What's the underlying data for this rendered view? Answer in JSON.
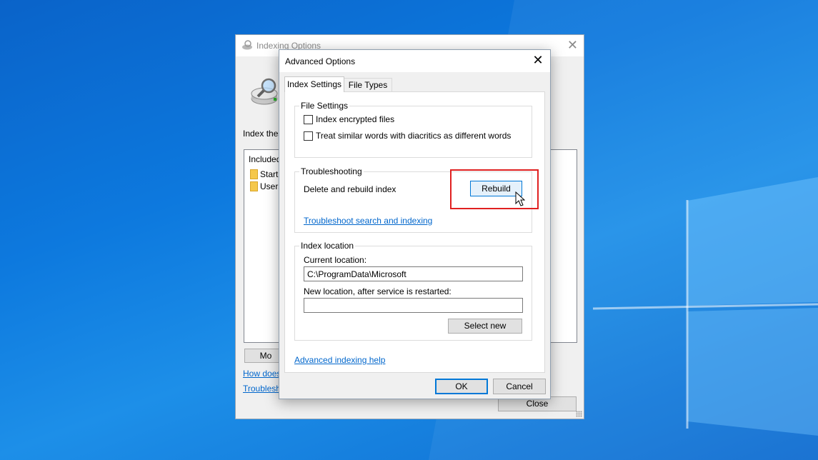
{
  "colors": {
    "accent": "#0078d7",
    "link": "#0066cc",
    "highlight": "#e02020"
  },
  "bg_window": {
    "title": "Indexing Options",
    "index_label": "Index thes",
    "list_header": "Included",
    "list_items": [
      "Start",
      "Users"
    ],
    "modify_label": "Mo",
    "how_link": "How does",
    "troubleshoot_link": "Troubleshoo",
    "close_label": "Close"
  },
  "dialog": {
    "title": "Advanced Options",
    "tabs": [
      "Index Settings",
      "File Types"
    ],
    "file_settings": {
      "legend": "File Settings",
      "options": [
        {
          "label": "Index encrypted files",
          "checked": false
        },
        {
          "label": "Treat similar words with diacritics as different words",
          "checked": false
        }
      ]
    },
    "troubleshooting": {
      "legend": "Troubleshooting",
      "delete_label": "Delete and rebuild index",
      "rebuild_label": "Rebuild",
      "link": "Troubleshoot search and indexing"
    },
    "index_location": {
      "legend": "Index location",
      "current_label": "Current location:",
      "current_value": "C:\\ProgramData\\Microsoft",
      "new_label": "New location, after service is restarted:",
      "new_value": "",
      "select_new_label": "Select new"
    },
    "help_link": "Advanced indexing help",
    "ok_label": "OK",
    "cancel_label": "Cancel"
  }
}
